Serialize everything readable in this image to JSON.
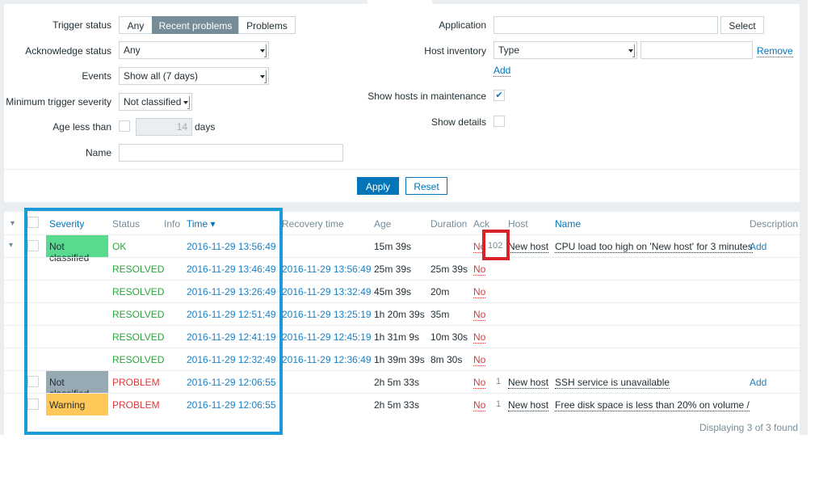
{
  "filter": {
    "trigger_status_label": "Trigger status",
    "trigger_status_options": [
      "Any",
      "Recent problems",
      "Problems"
    ],
    "ack_status_label": "Acknowledge status",
    "ack_status_value": "Any",
    "events_label": "Events",
    "events_value": "Show all (7 days)",
    "min_severity_label": "Minimum trigger severity",
    "min_severity_value": "Not classified",
    "age_label": "Age less than",
    "age_value": "14",
    "age_unit": "days",
    "name_label": "Name",
    "name_value": "",
    "application_label": "Application",
    "application_value": "",
    "select_label": "Select",
    "host_inventory_label": "Host inventory",
    "host_inventory_field": "Type",
    "host_inventory_value": "",
    "remove_label": "Remove",
    "add_label": "Add",
    "maintenance_label": "Show hosts in maintenance",
    "details_label": "Show details",
    "apply_label": "Apply",
    "reset_label": "Reset"
  },
  "table": {
    "headers": {
      "severity": "Severity",
      "status": "Status",
      "info": "Info",
      "time": "Time ▾",
      "recovery": "Recovery time",
      "age": "Age",
      "duration": "Duration",
      "ack": "Ack",
      "host": "Host",
      "name": "Name",
      "description": "Description"
    },
    "rows": [
      {
        "expand": "▾",
        "check": true,
        "severity": "Not classified",
        "sev_color": "#59db8f",
        "status": "OK",
        "status_class": "green",
        "time": "2016-11-29 13:56:49",
        "recovery": "",
        "age": "15m 39s",
        "duration": "",
        "ack": "No",
        "ack_count": "102",
        "host": "New host",
        "name": "CPU load too high on 'New host' for 3 minutes",
        "description": "Add"
      },
      {
        "status": "RESOLVED",
        "status_class": "green",
        "time": "2016-11-29 13:46:49",
        "recovery": "2016-11-29 13:56:49",
        "age": "25m 39s",
        "duration": "25m 39s",
        "ack": "No"
      },
      {
        "status": "RESOLVED",
        "status_class": "green",
        "time": "2016-11-29 13:26:49",
        "recovery": "2016-11-29 13:32:49",
        "age": "45m 39s",
        "duration": "20m",
        "ack": "No"
      },
      {
        "status": "RESOLVED",
        "status_class": "green",
        "time": "2016-11-29 12:51:49",
        "recovery": "2016-11-29 13:25:19",
        "age": "1h 20m 39s",
        "duration": "35m",
        "ack": "No"
      },
      {
        "status": "RESOLVED",
        "status_class": "green",
        "time": "2016-11-29 12:41:19",
        "recovery": "2016-11-29 12:45:19",
        "age": "1h 31m 9s",
        "duration": "10m 30s",
        "ack": "No"
      },
      {
        "status": "RESOLVED",
        "status_class": "green",
        "time": "2016-11-29 12:32:49",
        "recovery": "2016-11-29 12:36:49",
        "age": "1h 39m 39s",
        "duration": "8m 30s",
        "ack": "No"
      },
      {
        "check": true,
        "severity": "Not classified",
        "sev_color": "#97aab3",
        "status": "PROBLEM",
        "status_class": "red",
        "time": "2016-11-29 12:06:55",
        "recovery": "",
        "age": "2h 5m 33s",
        "duration": "",
        "ack": "No",
        "ack_count": "1",
        "host": "New host",
        "name": "SSH service is unavailable",
        "description": "Add"
      },
      {
        "check": true,
        "severity": "Warning",
        "sev_color": "#ffc859",
        "status": "PROBLEM",
        "status_class": "red",
        "time": "2016-11-29 12:06:55",
        "recovery": "",
        "age": "2h 5m 33s",
        "duration": "",
        "ack": "No",
        "ack_count": "1",
        "host": "New host",
        "name": "Free disk space is less than 20% on volume /",
        "description": ""
      }
    ],
    "footer": "Displaying 3 of 3 found"
  },
  "colors": {
    "highlight_blue": "#1a9ad6",
    "highlight_red": "#d9232b",
    "accent": "#0275b8"
  }
}
